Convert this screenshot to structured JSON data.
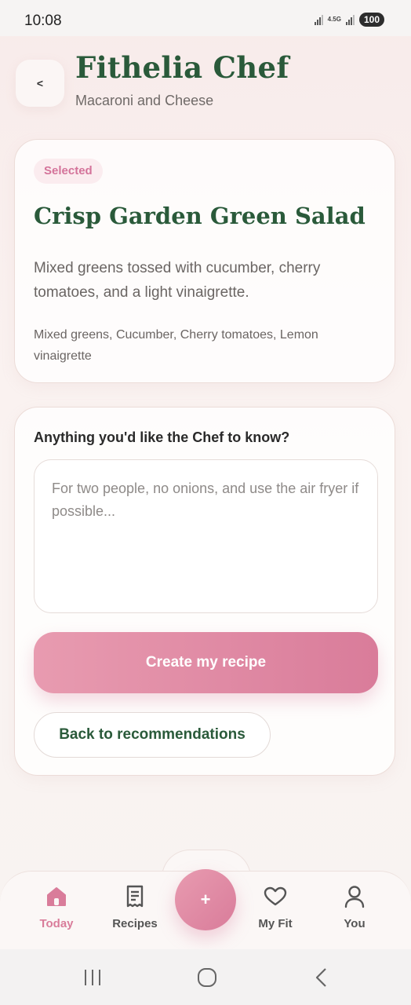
{
  "status_bar": {
    "time": "10:08",
    "network": "4.5G",
    "battery": "100"
  },
  "header": {
    "title": "Fithelia Chef",
    "subtitle": "Macaroni and Cheese",
    "back_label": "<"
  },
  "selected_card": {
    "badge": "Selected",
    "name": "Crisp Garden Green Salad",
    "description": "Mixed greens tossed with cucumber, cherry tomatoes, and a light vinaigrette.",
    "ingredients": "Mixed greens, Cucumber, Cherry tomatoes, Lemon vinaigrette"
  },
  "chef_card": {
    "label": "Anything you'd like the Chef to know?",
    "input_value": "",
    "input_placeholder": "For two people, no onions, and use the air fryer if possible...",
    "create_button": "Create my recipe",
    "back_button": "Back to recommendations"
  },
  "bottom_nav": {
    "items": [
      {
        "label": "Today",
        "icon": "home-icon",
        "active": true
      },
      {
        "label": "Recipes",
        "icon": "recipe-book-icon",
        "active": false
      },
      {
        "label": "My Fit",
        "icon": "heart-icon",
        "active": false
      },
      {
        "label": "You",
        "icon": "user-icon",
        "active": false
      }
    ],
    "fab_label": "+"
  },
  "colors": {
    "accent_pink": "#d97c9a",
    "brand_green": "#2a5a3a",
    "background": "#f8ebea"
  }
}
